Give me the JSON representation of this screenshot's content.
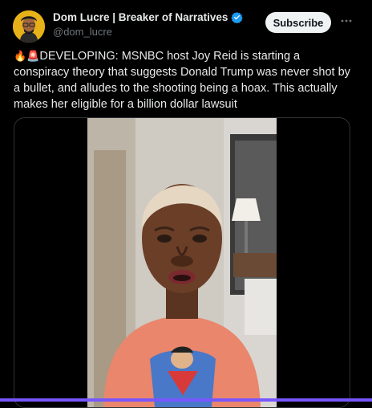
{
  "author": {
    "name": "Dom Lucre | Breaker of Narratives",
    "handle": "@dom_lucre",
    "verified": true
  },
  "actions": {
    "subscribe_label": "Subscribe",
    "more_icon": "more-horizontal-icon"
  },
  "post": {
    "emoji_1": "🔥",
    "emoji_2": "🚨",
    "text": "DEVELOPING: MSNBC host Joy Reid is starting a conspiracy theory that suggests Donald Trump was never shot by a bullet, and alludes to the shooting being a hoax. This actually makes her eligible for a billion dollar lawsuit"
  },
  "colors": {
    "background": "#000000",
    "text": "#e7e9ea",
    "secondary_text": "#71767b",
    "verified_badge": "#1d9bf0",
    "subscribe_bg": "#eff3f4",
    "accent_line": "#7856ff"
  }
}
